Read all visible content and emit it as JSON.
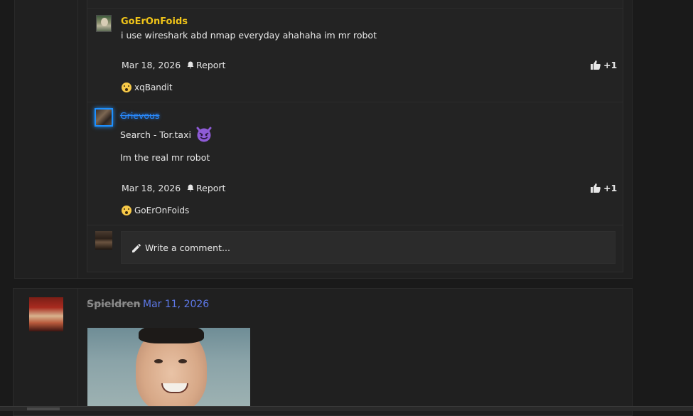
{
  "comments": [
    {
      "username": "GoErOnFoids",
      "lines": [
        "i use wireshark abd nmap everyday ahahaha im mr robot"
      ],
      "date": "Mar 18, 2026",
      "report_label": "Report",
      "like_count": "+1",
      "reaction_user": "xqBandit"
    },
    {
      "username": "Grievous",
      "lines": [
        "Search - Tor.taxi",
        "Im the real mr robot"
      ],
      "date": "Mar 18, 2026",
      "report_label": "Report",
      "like_count": "+1",
      "reaction_user": "GoErOnFoids"
    }
  ],
  "comment_input": {
    "placeholder": "Write a comment..."
  },
  "post": {
    "author": "Spieldren",
    "separator": "·",
    "date": "Mar 11, 2026"
  },
  "colors": {
    "username_gold": "#f0c419",
    "username_blue": "#2a8cff",
    "date_link": "#5d78e8"
  },
  "icons": [
    "bell-icon",
    "thumbs-up-icon",
    "pencil-icon",
    "surprised-emoji-icon",
    "devil-emoji-icon"
  ]
}
